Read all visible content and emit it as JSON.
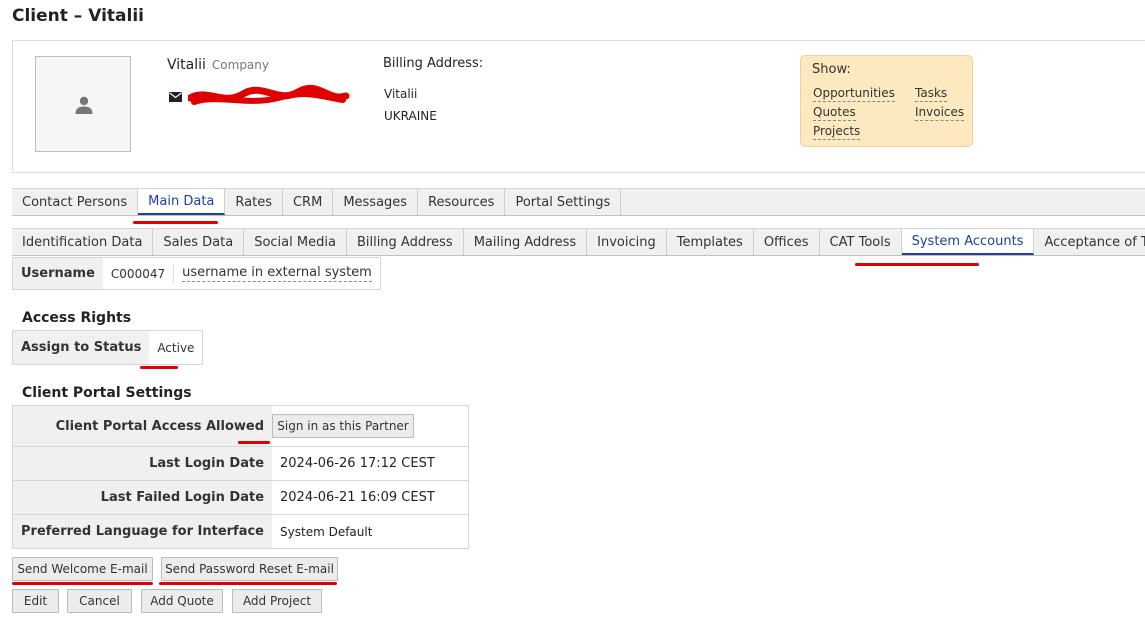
{
  "page": {
    "title": "Client – Vitalii"
  },
  "client": {
    "name": "Vitalii",
    "type": "Company",
    "billing_label": "Billing Address:",
    "billing_lines": [
      "Vitalii",
      "UKRAINE"
    ]
  },
  "show": {
    "title": "Show:",
    "links": [
      "Opportunities",
      "Quotes",
      "Projects",
      "Tasks",
      "Invoices"
    ]
  },
  "main_tabs": [
    "Contact Persons",
    "Main Data",
    "Rates",
    "CRM",
    "Messages",
    "Resources",
    "Portal Settings"
  ],
  "main_tab_active": "Main Data",
  "sub_tabs": [
    "Identification Data",
    "Sales Data",
    "Social Media",
    "Billing Address",
    "Mailing Address",
    "Invoicing",
    "Templates",
    "Offices",
    "CAT Tools",
    "System Accounts",
    "Acceptance of Terms"
  ],
  "sub_tab_active": "System Accounts",
  "username": {
    "label": "Username",
    "value": "C000047",
    "external_placeholder": "username in external system"
  },
  "access_rights": {
    "title": "Access Rights",
    "label": "Assign to Status",
    "value": "Active"
  },
  "portal": {
    "title": "Client Portal Settings",
    "access_label": "Client Portal Access Allowed",
    "access_checked": true,
    "sign_in_button": "Sign in as this Partner",
    "last_login_label": "Last Login Date",
    "last_login_value": "2024-06-26 17:12 CEST",
    "last_failed_label": "Last Failed Login Date",
    "last_failed_value": "2024-06-21 16:09 CEST",
    "language_label": "Preferred Language for Interface",
    "language_value": "System Default"
  },
  "buttons": {
    "welcome": "Send Welcome E-mail",
    "reset": "Send Password Reset E-mail",
    "edit": "Edit",
    "cancel": "Cancel",
    "add_quote": "Add Quote",
    "add_project": "Add Project"
  },
  "colors": {
    "accent": "#1c3faa",
    "annotation": "#e00000",
    "show_box": "#fde9c0"
  }
}
